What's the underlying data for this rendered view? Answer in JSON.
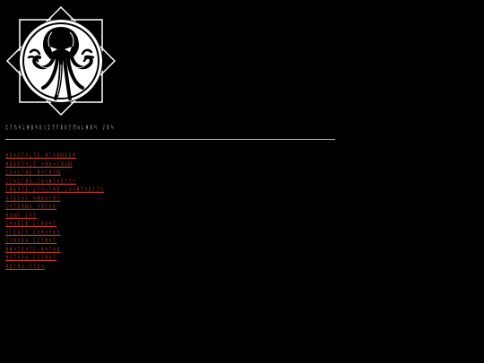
{
  "header": {
    "logo_icon": "cthulhu-emblem-icon",
    "title": "ᛈᚪᚢᛋᚳᚻᛒᛋᚱᛁᛈᛏᚨᛒᚱᚪᛖᛟᚳᚻᛒᛋ ᛇᛒᛋ"
  },
  "nav": {
    "items": [
      {
        "label": "ᚻᛒᛟᚢᛏᛋᚳᛏᛒ ᚻᚪᛋᛒᛞᚱᛒᚻ"
      },
      {
        "label": "ᚻᛒᛟᚢᛏᛋᚳᛏ ᛋᚻᛒᛋᚪᚻᛟᛞ"
      },
      {
        "label": "ᛈᛈᛋᚳᚪᚻᛒ ᚻᛋᚪᛒᛏᛞ"
      },
      {
        "label": "ᛈᚪᛋᚳᚪᚻᛒ ᛇᛟᛋᚻᛏᛋᛒᚪᛏᛋ"
      },
      {
        "label": "ᛏᚻᛒᛋᛏᛒ ᛈᚪᛋᚳᚪᚻᛒ ᛇᛟᛋᚻᛏᛋᛒᚪᛏᛋ"
      },
      {
        "label": "ᛋᛏᛒᚪᛋᛏ ᛋᚻᛒᛟᚪᚻᛏ"
      },
      {
        "label": "ᛈᛋᛏᛒᚻᛞᛟ ᛋᚻᛏᛋᛒ"
      },
      {
        "label": "ᚻᛟᛞᚢ ᛇᛋᛏ"
      },
      {
        "label": "ᛈᛋᛟᛒᛈᛒ ᛈᛁᚻᛒᛋᛏ"
      },
      {
        "label": "ᛋᚪᛒᛟᚪᛏ ᛈᛋᚻᛋᛏᛒᛋ"
      },
      {
        "label": "ᛈᛏᚻᛋᛒᛟ ᛈᛈᛏᚻᛋᛏ"
      },
      {
        "label": "ᚻᚻᛋᚪᛒᛋᛏᛈ ᛒᛋᛏᛟᛒ"
      },
      {
        "label": "ᚻᛟᛏᛋᛒᛟ ᛈᛈᛏᚻᛋᛏ"
      },
      {
        "label": "ᚻᛒᛏᚻᛟ ᛋᛏᛒᛋ"
      }
    ]
  },
  "colors": {
    "background": "#000000",
    "title_text": "#e8e8e8",
    "link": "#e1462f",
    "divider": "#bdbdbd"
  }
}
